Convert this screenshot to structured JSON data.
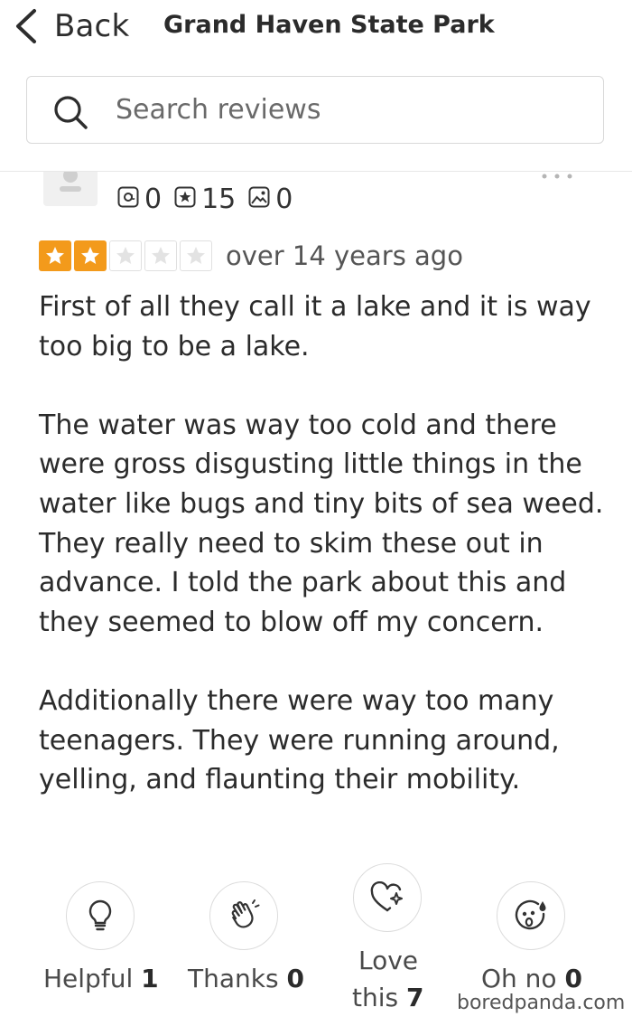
{
  "header": {
    "back_label": "Back",
    "title": "Grand Haven State Park"
  },
  "search": {
    "placeholder": "Search reviews"
  },
  "reviewer": {
    "stats": [
      {
        "icon": "at-sign-icon",
        "value": "0"
      },
      {
        "icon": "star-badge-icon",
        "value": "15"
      },
      {
        "icon": "photo-icon",
        "value": "0"
      }
    ]
  },
  "review": {
    "rating": 2,
    "rating_max": 5,
    "date": "over 14 years ago",
    "paragraphs": [
      "First of all they call it a lake and it is way too big to be a lake.",
      "The water was way too cold and there were gross disgusting little things in the water like bugs and tiny bits of sea weed.  They really need to skim these out in advance.  I told the park about this and they seemed to blow off my concern.",
      "Additionally there were way too many teenagers.  They were running around, yelling, and flaunting their mobility."
    ]
  },
  "reactions": {
    "helpful": {
      "label": "Helpful",
      "count": "1"
    },
    "thanks": {
      "label": "Thanks",
      "count": "0"
    },
    "love": {
      "label_line1": "Love",
      "label_line2": "this",
      "count": "7"
    },
    "oh_no": {
      "label": "Oh no",
      "count": "0"
    }
  },
  "watermark": "boredpanda.com",
  "colors": {
    "star_filled": "#f39a1b",
    "star_empty_border": "#e0e0e0",
    "text": "#2b2b2b"
  }
}
